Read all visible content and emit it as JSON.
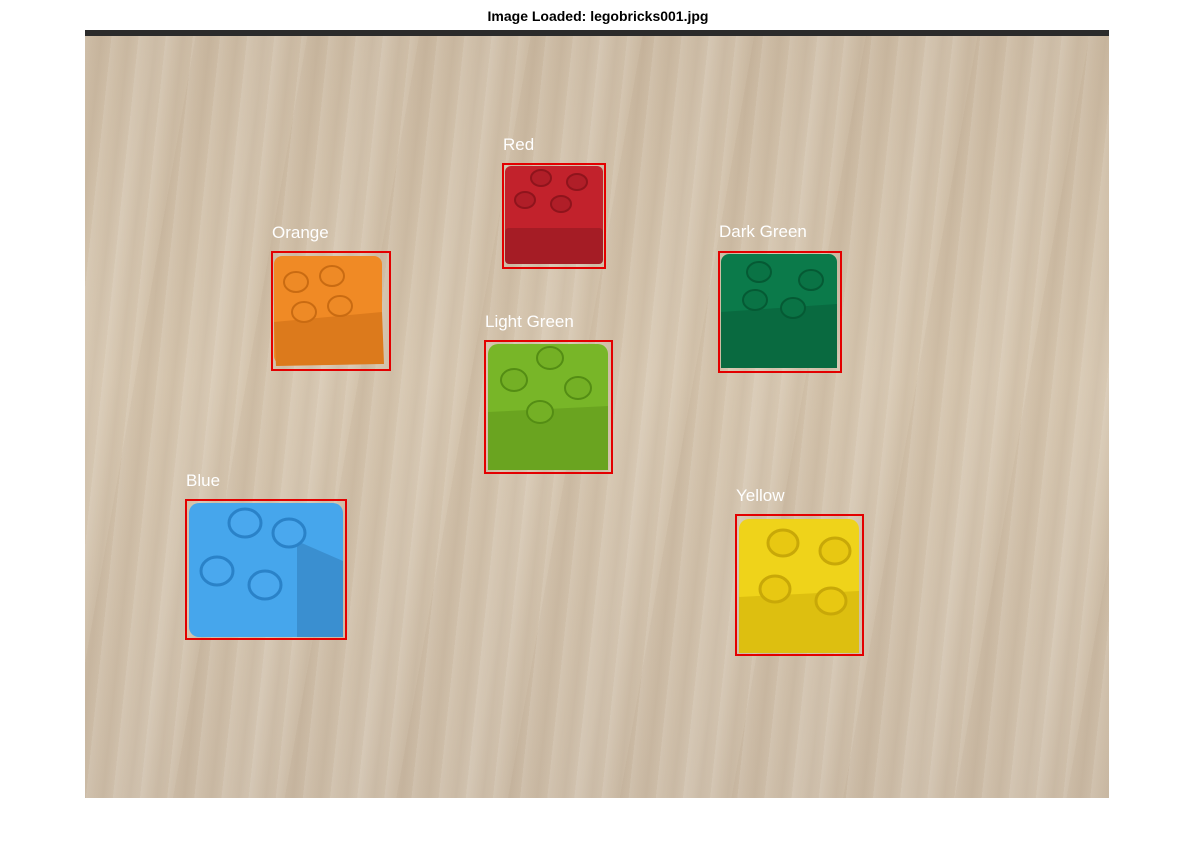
{
  "figure": {
    "title": "Image Loaded: legobricks001.jpg"
  },
  "detections": [
    {
      "label": "Red",
      "color": "#c2222c",
      "stud": "#a81822"
    },
    {
      "label": "Orange",
      "color": "#f08a25",
      "stud": "#d9761a"
    },
    {
      "label": "Dark Green",
      "color": "#0b7a4a",
      "stud": "#07663c"
    },
    {
      "label": "Light Green",
      "color": "#78b628",
      "stud": "#5f9a1a"
    },
    {
      "label": "Blue",
      "color": "#46a6ec",
      "stud": "#2f8ed6"
    },
    {
      "label": "Yellow",
      "color": "#efd31a",
      "stud": "#d9b70e"
    }
  ],
  "box_color": "#e30000"
}
